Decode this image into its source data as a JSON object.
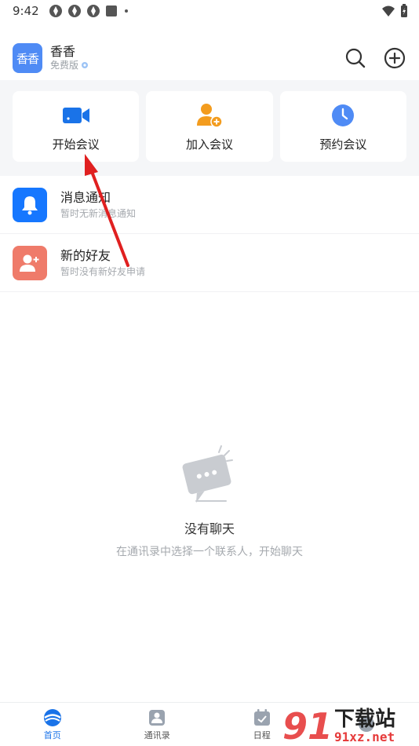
{
  "status_bar": {
    "time": "9:42"
  },
  "header": {
    "avatar_text": "香香",
    "user_name": "香香",
    "plan": "免费版"
  },
  "quick_actions": [
    {
      "label": "开始会议",
      "icon": "video-camera-icon",
      "color": "#1a73e8"
    },
    {
      "label": "加入会议",
      "icon": "add-person-icon",
      "color": "#f39c1e"
    },
    {
      "label": "预约会议",
      "icon": "clock-icon",
      "color": "#4f8bf5"
    }
  ],
  "list": [
    {
      "title": "消息通知",
      "subtitle": "暂时无新消息通知",
      "icon": "bell-icon",
      "color": "#1677ff"
    },
    {
      "title": "新的好友",
      "subtitle": "暂时没有新好友申请",
      "icon": "new-friend-icon",
      "color": "#ef7b6a"
    }
  ],
  "empty_state": {
    "title": "没有聊天",
    "subtitle": "在通讯录中选择一个联系人，开始聊天"
  },
  "bottom_nav": [
    {
      "label": "首页",
      "icon": "home-icon",
      "active": true
    },
    {
      "label": "通讯录",
      "icon": "contacts-icon",
      "active": false
    },
    {
      "label": "日程",
      "icon": "calendar-icon",
      "active": false
    }
  ],
  "watermark": {
    "logo": "91",
    "text": "下载站",
    "url": "91xz.net"
  },
  "colors": {
    "accent": "#1a73e8",
    "annotation_arrow": "#e02020"
  }
}
